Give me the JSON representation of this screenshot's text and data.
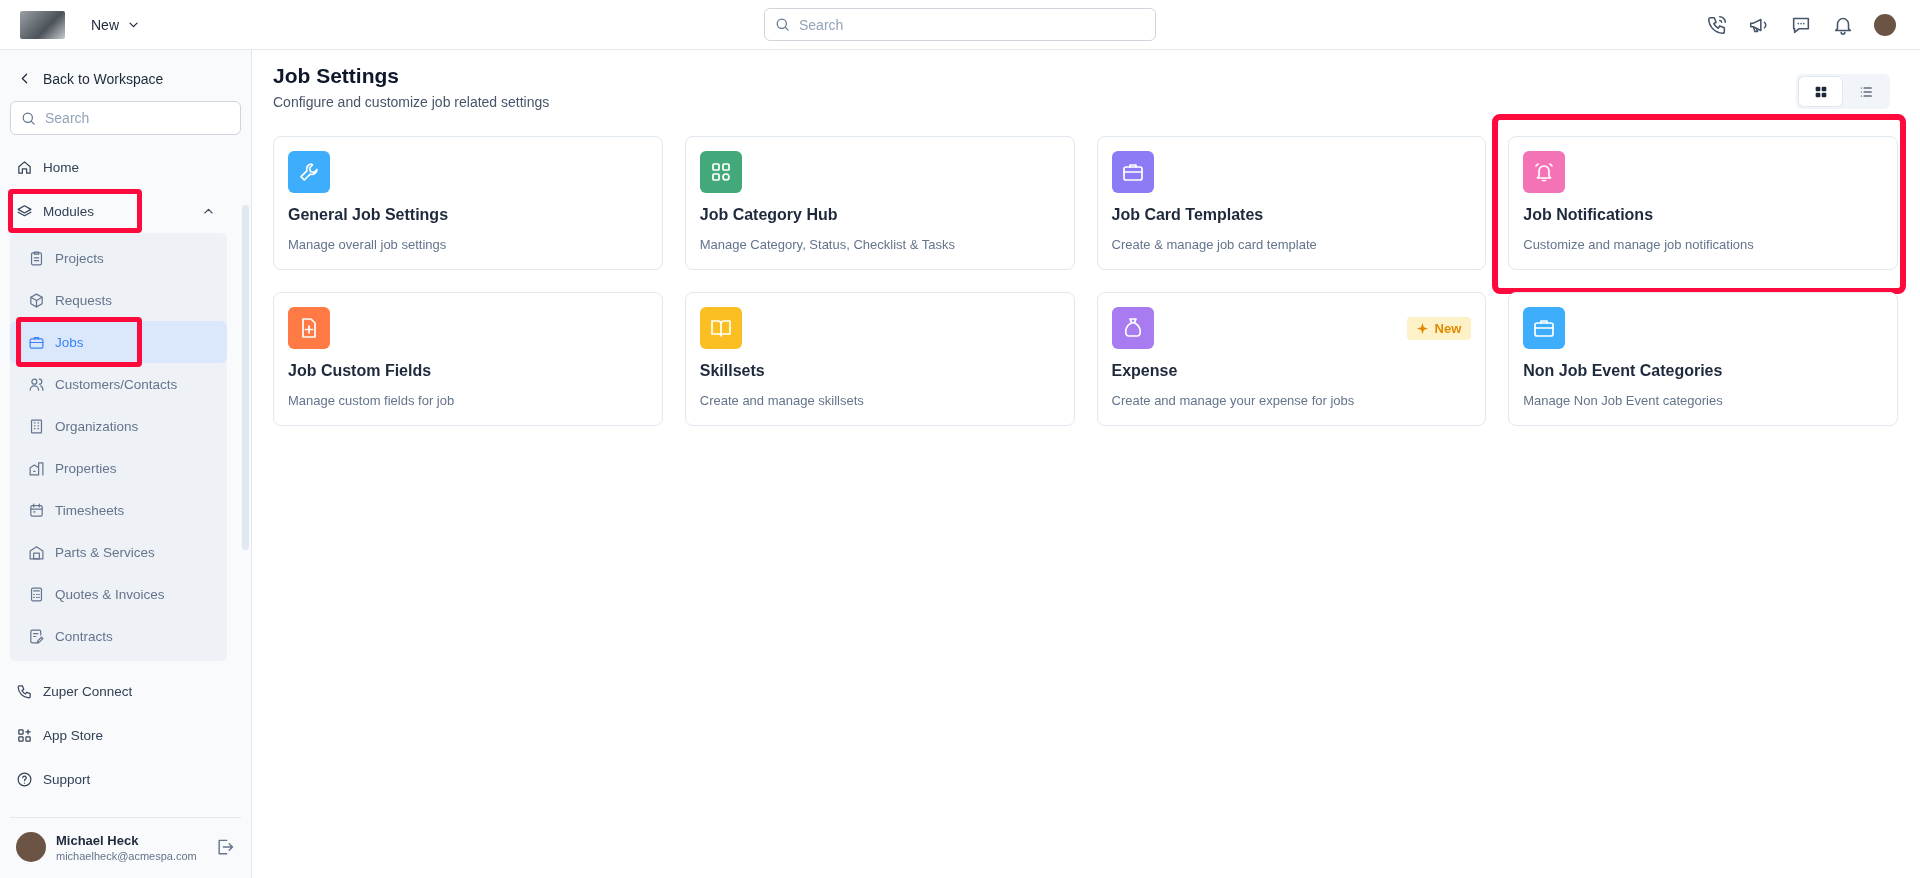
{
  "topbar": {
    "new_menu": "New",
    "search": {
      "placeholder": "Search"
    }
  },
  "sidebar": {
    "back": "Back to Workspace",
    "search": {
      "placeholder": "Search"
    },
    "items": [
      {
        "label": "Home",
        "kind": "link",
        "highlighted": false
      },
      {
        "label": "Modules",
        "kind": "group",
        "expanded": true,
        "highlighted": true,
        "children": [
          {
            "label": "Projects",
            "selected": false,
            "highlighted": false
          },
          {
            "label": "Requests",
            "selected": false,
            "highlighted": false
          },
          {
            "label": "Jobs",
            "selected": true,
            "highlighted": true
          },
          {
            "label": "Customers/Contacts",
            "selected": false,
            "highlighted": false
          },
          {
            "label": "Organizations",
            "selected": false,
            "highlighted": false
          },
          {
            "label": "Properties",
            "selected": false,
            "highlighted": false
          },
          {
            "label": "Timesheets",
            "selected": false,
            "highlighted": false
          },
          {
            "label": "Parts & Services",
            "selected": false,
            "highlighted": false
          },
          {
            "label": "Quotes & Invoices",
            "selected": false,
            "highlighted": false
          },
          {
            "label": "Contracts",
            "selected": false,
            "highlighted": false
          }
        ]
      },
      {
        "label": "Zuper Connect",
        "kind": "link",
        "highlighted": false
      },
      {
        "label": "App Store",
        "kind": "link",
        "highlighted": false
      },
      {
        "label": "Support",
        "kind": "link",
        "highlighted": false
      }
    ],
    "user": {
      "name": "Michael Heck",
      "email": "michaelheck@acmespa.com"
    }
  },
  "page": {
    "title": "Job Settings",
    "subtitle": "Configure and customize job related settings",
    "view_toggle": [
      {
        "selected": true
      },
      {
        "selected": false
      }
    ],
    "cards": [
      {
        "title": "General Job Settings",
        "description": "Manage overall job settings",
        "color": "#3eaefc",
        "highlighted": false
      },
      {
        "title": "Job Category Hub",
        "description": "Manage Category, Status, Checklist & Tasks",
        "color": "#43a97a",
        "highlighted": false
      },
      {
        "title": "Job Card Templates",
        "description": "Create & manage job card template",
        "color": "#8b7cf6",
        "highlighted": false
      },
      {
        "title": "Job Notifications",
        "description": "Customize and manage job notifications",
        "color": "#f472b6",
        "highlighted": true
      },
      {
        "title": "Job Custom Fields",
        "description": "Manage custom fields for job",
        "color": "#ff7a45",
        "highlighted": false
      },
      {
        "title": "Skillsets",
        "description": "Create and manage skillsets",
        "color": "#fbbf24",
        "highlighted": false
      },
      {
        "title": "Expense",
        "description": "Create and manage your expense for jobs",
        "color": "#a87cf0",
        "highlighted": false,
        "badge": "New"
      },
      {
        "title": "Non Job Event Categories",
        "description": "Manage Non Job Event categories",
        "color": "#3eaefc",
        "highlighted": false
      }
    ]
  }
}
